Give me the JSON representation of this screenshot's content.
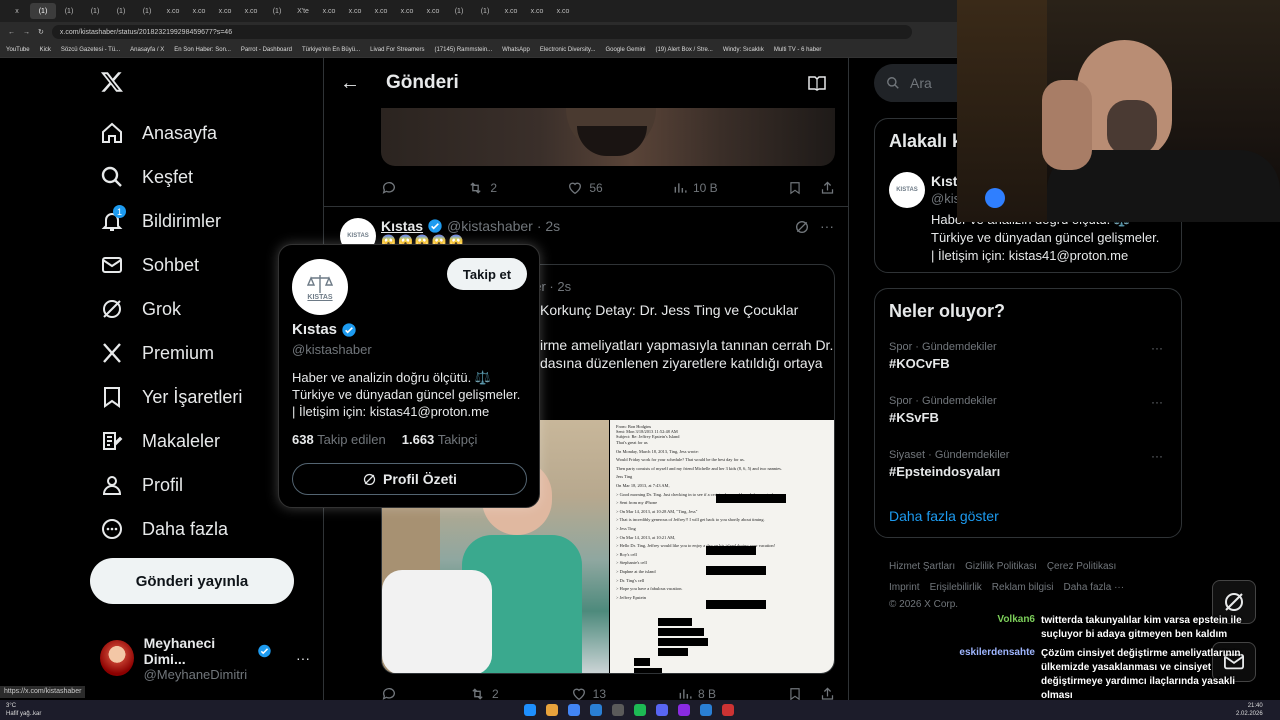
{
  "browser": {
    "tabs": [
      "x",
      "(1)",
      "(1)",
      "(1)",
      "(1)",
      "(1)",
      "x.co",
      "x.co",
      "x.co",
      "x.co",
      "(1)",
      "X'te",
      "x.co",
      "x.co",
      "x.co",
      "x.co",
      "x.co",
      "(1)",
      "(1)",
      "x.co",
      "x.co",
      "x.co"
    ],
    "url": "x.com/kistashaber/status/2018232199298459677?s=46",
    "bookmarks": [
      "YouTube",
      "Kick",
      "Sözcü Gazetesi - Tü...",
      "Anasayfa / X",
      "En Son Haber: Son...",
      "Parrot - Dashboard",
      "Türkiye'nin En Büyü...",
      "Livad For Streamers",
      "(17145) Rammstein...",
      "WhatsApp",
      "Electronic Diversity...",
      "Google Gemini",
      "(19) Alert Box / Stre...",
      "Windy: Sıcaklık",
      "Multi TV - 6 haber"
    ]
  },
  "nav": {
    "items": [
      "Anasayfa",
      "Keşfet",
      "Bildirimler",
      "Sohbet",
      "Grok",
      "Premium",
      "Yer İşaretleri",
      "Makaleler",
      "Profil",
      "Daha fazla"
    ],
    "notif_badge": "1",
    "post_button": "Gönderi yayınla",
    "account_name": "Meyhaneci Dimi...",
    "account_handle": "@MeyhaneDimitri",
    "account_more": "···"
  },
  "main": {
    "header_title": "Gönderi",
    "post1_actions": {
      "retweets": "2",
      "likes": "56",
      "views": "10 B"
    },
    "post2": {
      "author": "Kıstas",
      "handle": "@kistashaber",
      "time": "· 2s",
      "emoji_line": "😱😱😱😱😱",
      "quote_time": "ber · 2s",
      "quote_title": "Korkunç Detay: Dr. Jess Ting ve Çocuklar",
      "quote_line1": "irme ameliyatları yapmasıyla tanınan cerrah Dr.",
      "quote_line2": "dasına düzenlenen ziyaretlere katıldığı ortaya",
      "actions": {
        "retweets": "2",
        "likes": "13",
        "views": "8 B"
      }
    },
    "doc_lines": [
      "From: Bon Hodgins",
      "Sent: Mon 3/18/2013 11:52:48 AM",
      "Subject: Re: Jeffrey Epstein's Island",
      "That's great for us",
      "On Monday, March 18, 2013, Ting, Jess wrote:",
      "Would Friday work for your schedule? That would be the best day for us.",
      "Then party consists of myself and my friend Michelle and her 3 kids (8, 6, 5) and two nannies.",
      "Jess Ting",
      "On Mar 18, 2013, at 7:43 AM,",
      "> Good morning Dr. Ting. Just checking in to see if a certain day would work for you to have",
      "> Sent from my iPhone",
      "> On Mar 14, 2013, at 10:28 AM, \"Ting, Jess\"",
      "> That is incredibly generous of Jeffrey!! I will get back to you shortly about timing.",
      "> Jess Ting",
      "> On Mar 14, 2013, at 10:21 AM,",
      "> Hello Dr. Ting, Jeffrey would like you to enjoy a day on his island during your vacation!",
      "> Roy's cell",
      "> Stephanie's cell",
      "> Daphne at the island",
      "> Dr. Ting's cell",
      "> Hope you have a fabulous vacation.",
      "> Jeffrey Epstein"
    ]
  },
  "hover_card": {
    "follow_button": "Takip et",
    "logo_text": "KISTAS",
    "name": "Kıstas",
    "handle": "@kistashaber",
    "bio_line1": "Haber ve analizin doğru ölçütü. ⚖️",
    "bio_line2": "Türkiye ve dünyadan güncel gelişmeler.",
    "bio_line3": "| İletişim için: kistas41@proton.me",
    "following_count": "638",
    "following_label": "Takip edilen",
    "followers_count": "1.663",
    "followers_label": "Takipçi",
    "profile_summary": "Profil Özeti"
  },
  "right": {
    "search_placeholder": "Ara",
    "related_title": "Alakalı k",
    "related_name": "Kıst",
    "related_handle": "@kis",
    "related_bio1": "Haber ve analizin doğru ölçütü. ⚖️",
    "related_bio2": "Türkiye ve dünyadan güncel gelişmeler.",
    "related_bio3": "| İletişim için: kistas41@proton.me",
    "trends_title": "Neler oluyor?",
    "trends": [
      {
        "category": "Spor · Gündemdekiler",
        "name": "#KOCvFB"
      },
      {
        "category": "Spor · Gündemdekiler",
        "name": "#KSvFB"
      },
      {
        "category": "Siyaset · Gündemdekiler",
        "name": "#Epsteindosyaları"
      }
    ],
    "show_more": "Daha fazla göster",
    "footer_line1": [
      "Hizmet Şartları",
      "Gizlilik Politikası",
      "Çerez Politikası"
    ],
    "footer_line2": [
      "Imprint",
      "Erişilebilirlik",
      "Reklam bilgisi",
      "Daha fazla ···"
    ],
    "copyright": "© 2026 X Corp."
  },
  "chat": [
    {
      "user": "Volkan6",
      "color": "#7ccf5a",
      "msg": "twitterda takunyalılar kim varsa epstein ile suçluyor bi adaya gitmeyen ben kaldım"
    },
    {
      "user": "eskilerdensahte",
      "color": "#9fb6ff",
      "msg": "Çözüm cinsiyet değiştirme ameliyatlarının ülkemizde yasaklanması ve cinsiyet değiştirmeye yardımcı ilaçlarında yasakli olması"
    }
  ],
  "status_url": "https://x.com/kistashaber",
  "taskbar": {
    "weather_temp": "3°C",
    "weather_desc": "Hafif yağ..kar",
    "time": "21:40",
    "date": "2.02.2026"
  },
  "colors": {
    "accent": "#1d9bf0",
    "bg": "#000000",
    "border": "#2f3336",
    "muted": "#71767b"
  }
}
